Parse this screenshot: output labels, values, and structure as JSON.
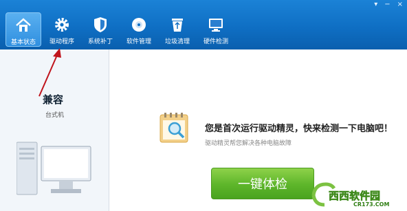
{
  "window_controls": {
    "menu": "▾",
    "minimize": "−",
    "close": "×"
  },
  "toolbar": {
    "items": [
      {
        "label": "基本状态",
        "icon": "home-icon",
        "active": true
      },
      {
        "label": "驱动程序",
        "icon": "gear-icon",
        "active": false
      },
      {
        "label": "系统补丁",
        "icon": "shield-icon",
        "active": false
      },
      {
        "label": "软件管理",
        "icon": "disc-icon",
        "active": false
      },
      {
        "label": "垃圾清理",
        "icon": "recycle-bin-icon",
        "active": false
      },
      {
        "label": "硬件检测",
        "icon": "monitor-icon",
        "active": false
      }
    ]
  },
  "sidebar": {
    "compat_label": "兼容",
    "device_type": "台式机"
  },
  "main": {
    "headline": "您是首次运行驱动精灵，快来检测一下电脑吧！",
    "subline": "驱动精灵帮您解决各种电脑故障",
    "check_button": "一键体检"
  },
  "watermark": {
    "text": "西西软件园",
    "site": "CR173.COM"
  },
  "colors": {
    "toolbar_bg": "#0f6fc4",
    "active_tab": "#3a9be6",
    "button_green": "#5db52a",
    "arrow": "#c0141c"
  }
}
